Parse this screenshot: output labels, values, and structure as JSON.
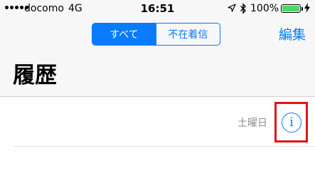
{
  "status_bar": {
    "carrier": "docomo",
    "network": "4G",
    "time": "16:51",
    "battery_percent": "100%",
    "battery_level": 1.0,
    "battery_color": "#4cd964",
    "icons": [
      "signal-dots-icon",
      "location-arrow-icon",
      "bluetooth-icon",
      "battery-icon",
      "charging-bolt-icon"
    ]
  },
  "nav": {
    "segments": [
      "すべて",
      "不在着信"
    ],
    "active_segment": 0,
    "edit_label": "編集",
    "accent_color": "#0a7aff"
  },
  "page": {
    "title": "履歴"
  },
  "list": {
    "items": [
      {
        "day": "土曜日",
        "info_icon": "info-circle-icon"
      }
    ]
  },
  "annotation": {
    "highlight_color": "#e0141b",
    "target": "info-circle-icon"
  }
}
